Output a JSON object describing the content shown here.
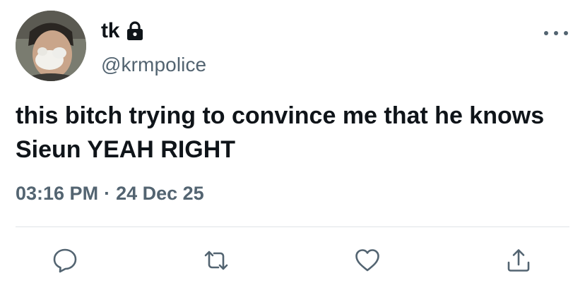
{
  "author": {
    "display_name": "tk",
    "handle": "@krmpolice",
    "protected_icon": "lock-icon",
    "avatar_icon": "profile-photo"
  },
  "tweet": {
    "text": "this bitch trying to convince me that he knows Sieun YEAH RIGHT"
  },
  "meta": {
    "time": "03:16 PM",
    "separator": "·",
    "date": "24 Dec 25"
  },
  "menu": {
    "icon": "more-horizontal-icon"
  },
  "actions": [
    {
      "name": "reply",
      "icon": "comment-icon"
    },
    {
      "name": "retweet",
      "icon": "retweet-icon"
    },
    {
      "name": "like",
      "icon": "heart-icon"
    },
    {
      "name": "share",
      "icon": "share-icon"
    }
  ],
  "colors": {
    "text": "#0f1419",
    "secondary": "#536471",
    "divider": "#dfe3e6",
    "background": "#ffffff"
  }
}
